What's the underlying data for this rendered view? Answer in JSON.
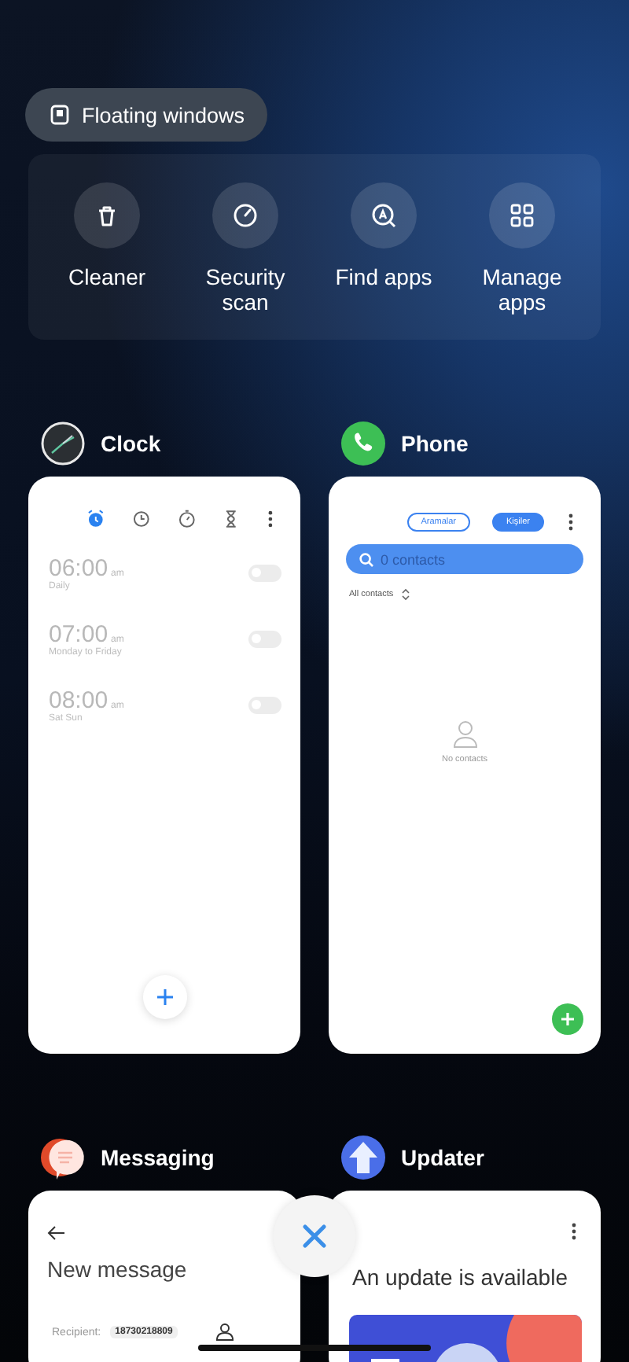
{
  "floating_windows": {
    "label": "Floating windows"
  },
  "quick_actions": [
    {
      "label": "Cleaner"
    },
    {
      "label": "Security scan"
    },
    {
      "label": "Find apps"
    },
    {
      "label": "Manage apps"
    }
  ],
  "recent_apps": [
    {
      "kind": "clock",
      "name": "Clock",
      "tabs": [
        {
          "selected": true
        },
        {
          "selected": false
        },
        {
          "selected": false
        },
        {
          "selected": false
        }
      ],
      "alarms": [
        {
          "time": "06:00",
          "period": "am",
          "repeat": "Daily",
          "on": false
        },
        {
          "time": "07:00",
          "period": "am",
          "repeat": "Monday to Friday",
          "on": false
        },
        {
          "time": "08:00",
          "period": "am",
          "repeat": "Sat Sun",
          "on": false
        }
      ]
    },
    {
      "kind": "phone",
      "name": "Phone",
      "tabs": [
        {
          "label": "Aramalar",
          "selected": false
        },
        {
          "label": "Kişiler",
          "selected": true
        }
      ],
      "search": {
        "placeholder": "0 contacts"
      },
      "filter": "All contacts",
      "empty": "No contacts"
    },
    {
      "kind": "messaging",
      "name": "Messaging",
      "title": "New message",
      "recipient_label": "Recipient:",
      "recipient": "18730218809"
    },
    {
      "kind": "updater",
      "name": "Updater",
      "title": "An update is available"
    }
  ]
}
